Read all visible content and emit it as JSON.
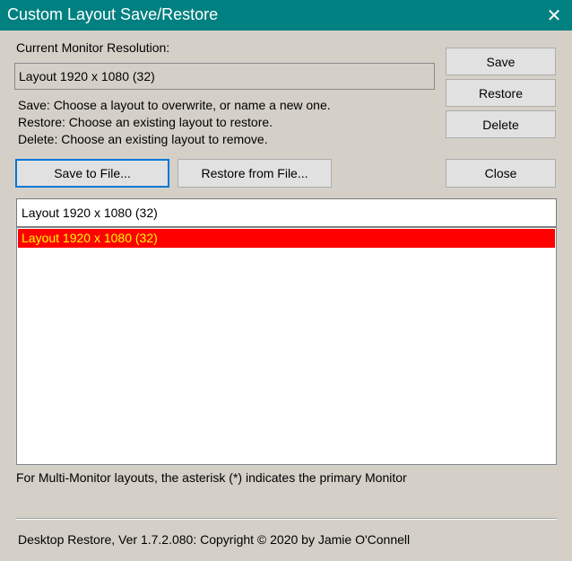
{
  "window": {
    "title": "Custom Layout Save/Restore",
    "close_glyph": "✕",
    "titlebar_color": "#008080"
  },
  "resolution": {
    "label": "Current Monitor Resolution:",
    "value": "Layout 1920 x 1080 (32)"
  },
  "instructions": [
    "Save: Choose a layout to overwrite, or name a new one.",
    "Restore: Choose an existing layout to restore.",
    "Delete: Choose an existing layout to remove."
  ],
  "buttons": {
    "save": "Save",
    "restore": "Restore",
    "delete": "Delete",
    "save_to_file": "Save to File...",
    "restore_from_file": "Restore from File...",
    "close": "Close"
  },
  "layout_name_input": {
    "value": "Layout 1920 x 1080 (32)"
  },
  "layouts": [
    {
      "label": "Layout 1920 x 1080 (32)",
      "selected": true,
      "highlight_bg": "#ff0000",
      "highlight_fg": "#ffff00"
    }
  ],
  "note": "For Multi-Monitor layouts, the asterisk (*) indicates the primary Monitor",
  "footer": "Desktop Restore, Ver 1.7.2.080: Copyright © 2020 by Jamie O'Connell"
}
